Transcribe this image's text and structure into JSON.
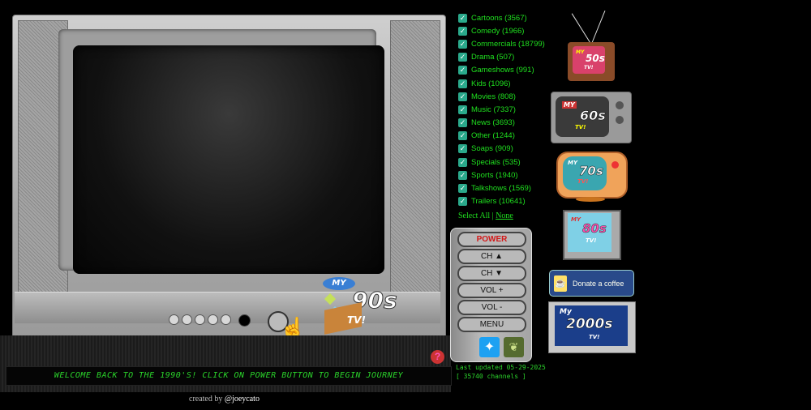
{
  "tv": {
    "logo": {
      "my": "MY",
      "decade": "90s",
      "tv": "TV!"
    },
    "power_label": "POWER"
  },
  "marquee_text": "WELCOME BACK TO THE 1990'S! CLICK ON POWER BUTTON TO BEGIN JOURNEY",
  "help_icon": "?",
  "credit": {
    "prefix": "created by ",
    "handle": "@joeycato"
  },
  "categories": [
    {
      "label": "Cartoons (3567)",
      "checked": true
    },
    {
      "label": "Comedy (1966)",
      "checked": true
    },
    {
      "label": "Commercials (18799)",
      "checked": true
    },
    {
      "label": "Drama (507)",
      "checked": true
    },
    {
      "label": "Gameshows (991)",
      "checked": true
    },
    {
      "label": "Kids (1096)",
      "checked": true
    },
    {
      "label": "Movies (808)",
      "checked": true
    },
    {
      "label": "Music (7337)",
      "checked": true
    },
    {
      "label": "News (3693)",
      "checked": true
    },
    {
      "label": "Other (1244)",
      "checked": true
    },
    {
      "label": "Soaps (909)",
      "checked": true
    },
    {
      "label": "Specials (535)",
      "checked": true
    },
    {
      "label": "Sports (1940)",
      "checked": true
    },
    {
      "label": "Talkshows (1569)",
      "checked": true
    },
    {
      "label": "Trailers (10641)",
      "checked": true
    }
  ],
  "select": {
    "all": "Select All",
    "separator": "|",
    "none": "None"
  },
  "remote": {
    "power": "POWER",
    "ch_up": "CH ▲",
    "ch_down": "CH ▼",
    "vol_up": "VOL +",
    "vol_down": "VOL -",
    "menu": "MENU"
  },
  "status": {
    "last_updated": "Last updated 05-29-2025",
    "channels": "[ 35740 channels ]"
  },
  "decades": {
    "d50": {
      "my": "MY",
      "decade": "50s",
      "tv": "TV!"
    },
    "d60": {
      "my": "MY",
      "decade": "60s",
      "tv": "TV!"
    },
    "d70": {
      "my": "MY",
      "decade": "70s",
      "tv": "TV!"
    },
    "d80": {
      "my": "MY",
      "decade": "80s",
      "tv": "TV!"
    },
    "d2000": {
      "my": "My",
      "decade": "2000s",
      "tv": "TV!"
    }
  },
  "donate": {
    "label": "Donate a coffee"
  },
  "colors": {
    "accent_green": "#1fe01f",
    "checkbox": "#2aa98b",
    "power_red": "#d31818",
    "twitter": "#1da1f2"
  }
}
